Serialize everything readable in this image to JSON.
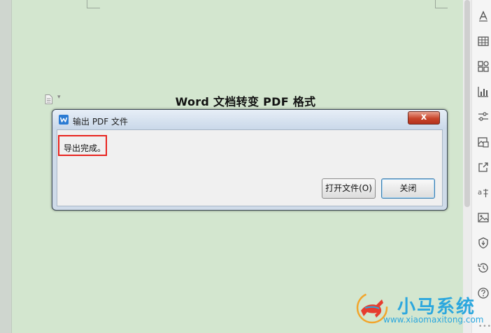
{
  "document": {
    "title": "Word 文档转变 PDF 格式"
  },
  "dialog": {
    "title": "输出 PDF 文件",
    "close_glyph": "x",
    "message": "导出完成。",
    "buttons": {
      "open_file": "打开文件(O)",
      "close": "关闭"
    }
  },
  "sidebar": {
    "icons": [
      "style-icon",
      "table-icon",
      "apps-icon",
      "chart-icon",
      "settings-sliders-icon",
      "image-gallery-icon",
      "share-icon",
      "translate-icon",
      "picture-icon",
      "shield-icon",
      "history-icon",
      "help-icon"
    ]
  },
  "watermark": {
    "brand": "小马系统",
    "url": "www.xiaomaxitong.com"
  },
  "colors": {
    "page_bg": "#d3e6cf",
    "highlight": "#e8231e",
    "watermark": "#2ba7de"
  }
}
